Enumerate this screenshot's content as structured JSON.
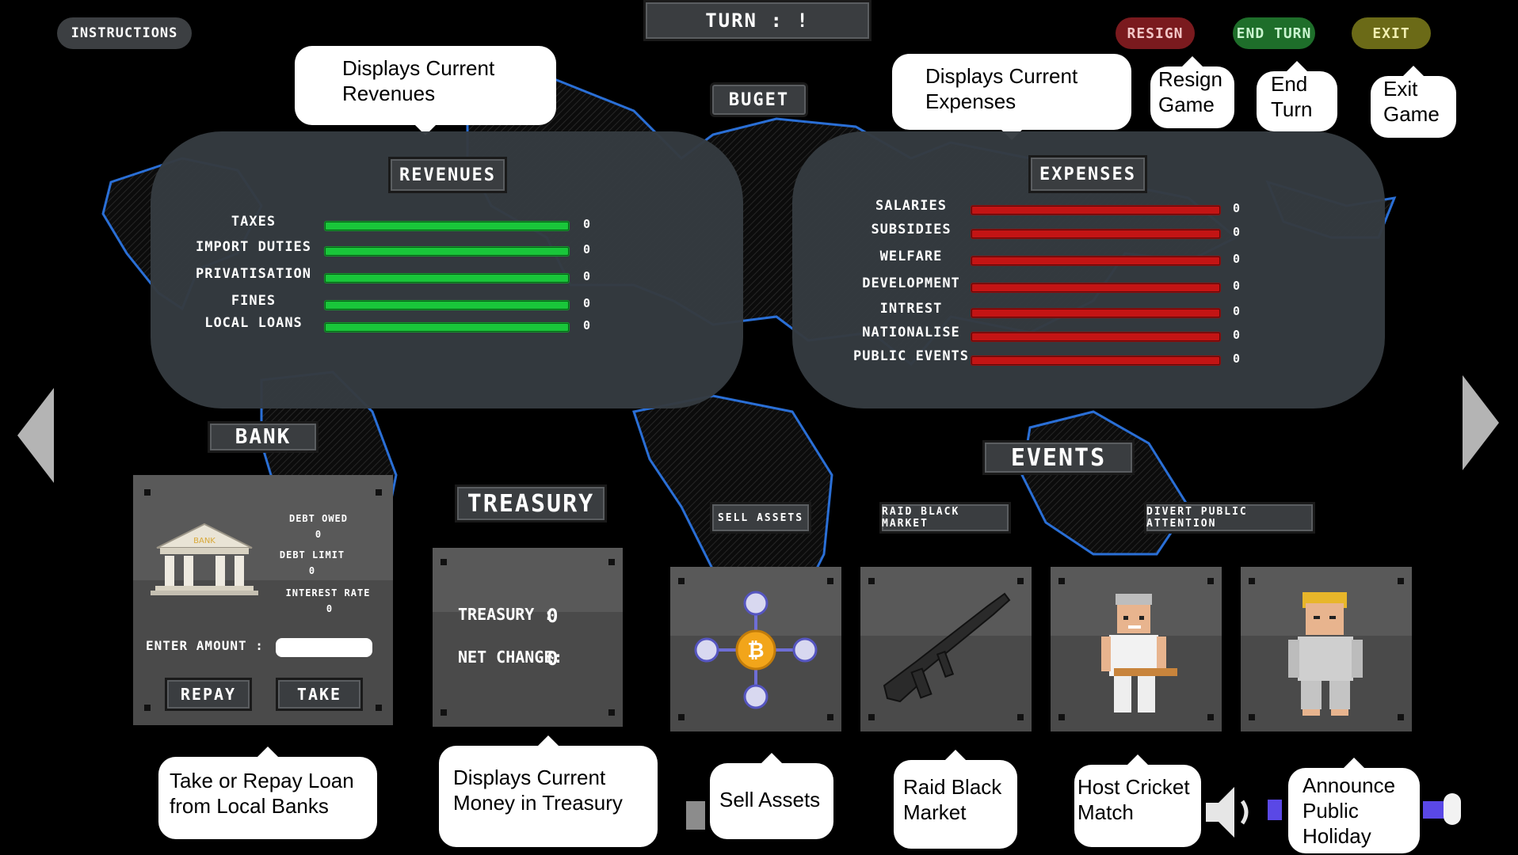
{
  "header": {
    "instructions_label": "INSTRUCTIONS",
    "turn_label": "TURN : !",
    "resign_label": "RESIGN",
    "end_turn_label": "END TURN",
    "exit_label": "EXIT",
    "budget_label": "BUGET"
  },
  "colors": {
    "resign": "#7a1a1e",
    "end_turn": "#1e6e2a",
    "exit": "#6b6a17",
    "revenue_bar": "#19c63a",
    "expense_bar": "#c31414"
  },
  "revenues": {
    "title": "REVENUES",
    "items": [
      {
        "label": "TAXES",
        "value": "0"
      },
      {
        "label": "IMPORT DUTIES",
        "value": "0"
      },
      {
        "label": "PRIVATISATION",
        "value": "0"
      },
      {
        "label": "FINES",
        "value": "0"
      },
      {
        "label": "LOCAL LOANS",
        "value": "0"
      }
    ]
  },
  "expenses": {
    "title": "EXPENSES",
    "items": [
      {
        "label": "SALARIES",
        "value": "0"
      },
      {
        "label": "SUBSIDIES",
        "value": "0"
      },
      {
        "label": "WELFARE",
        "value": "0"
      },
      {
        "label": "DEVELOPMENT",
        "value": "0"
      },
      {
        "label": "INTREST",
        "value": "0"
      },
      {
        "label": "NATIONALISE",
        "value": "0"
      },
      {
        "label": "PUBLIC EVENTS",
        "value": "0"
      }
    ]
  },
  "bank": {
    "title": "BANK",
    "sign": "BANK",
    "debt_owed_label": "DEBT OWED",
    "debt_owed_value": "0",
    "debt_limit_label": "DEBT LIMIT",
    "debt_limit_value": "0",
    "interest_rate_label": "INTEREST RATE",
    "interest_rate_value": "0",
    "enter_amount_label": "ENTER AMOUNT :",
    "amount_value": "",
    "repay_label": "REPAY",
    "take_label": "TAKE"
  },
  "treasury": {
    "title": "TREASURY",
    "treasury_label": "TREASURY :",
    "treasury_value": "0",
    "net_change_label": "NET CHANGE:",
    "net_change_value": "0"
  },
  "events": {
    "title": "EVENTS",
    "sell_assets_label": "SELL ASSETS",
    "raid_label": "RAID BLACK MARKET",
    "divert_label": "DIVERT PUBLIC ATTENTION"
  },
  "tooltips": {
    "revenues": "Displays Current Revenues",
    "expenses": "Displays Current Expenses",
    "resign": "Resign Game",
    "end_turn": "End Turn",
    "exit": "Exit Game",
    "bank": "Take or Repay Loan from Local Banks",
    "treasury": "Displays Current Money in Treasury",
    "sell": "Sell Assets",
    "raid": "Raid Black Market",
    "cricket": "Host Cricket Match",
    "holiday": "Announce Public Holiday"
  },
  "icons": {
    "sell": "bitcoin-network-icon",
    "raid": "rifle-icon",
    "cricket": "cricket-player-icon",
    "holiday": "holiday-person-icon",
    "volume": "speaker-icon"
  },
  "volume": {
    "level": 0.85
  }
}
